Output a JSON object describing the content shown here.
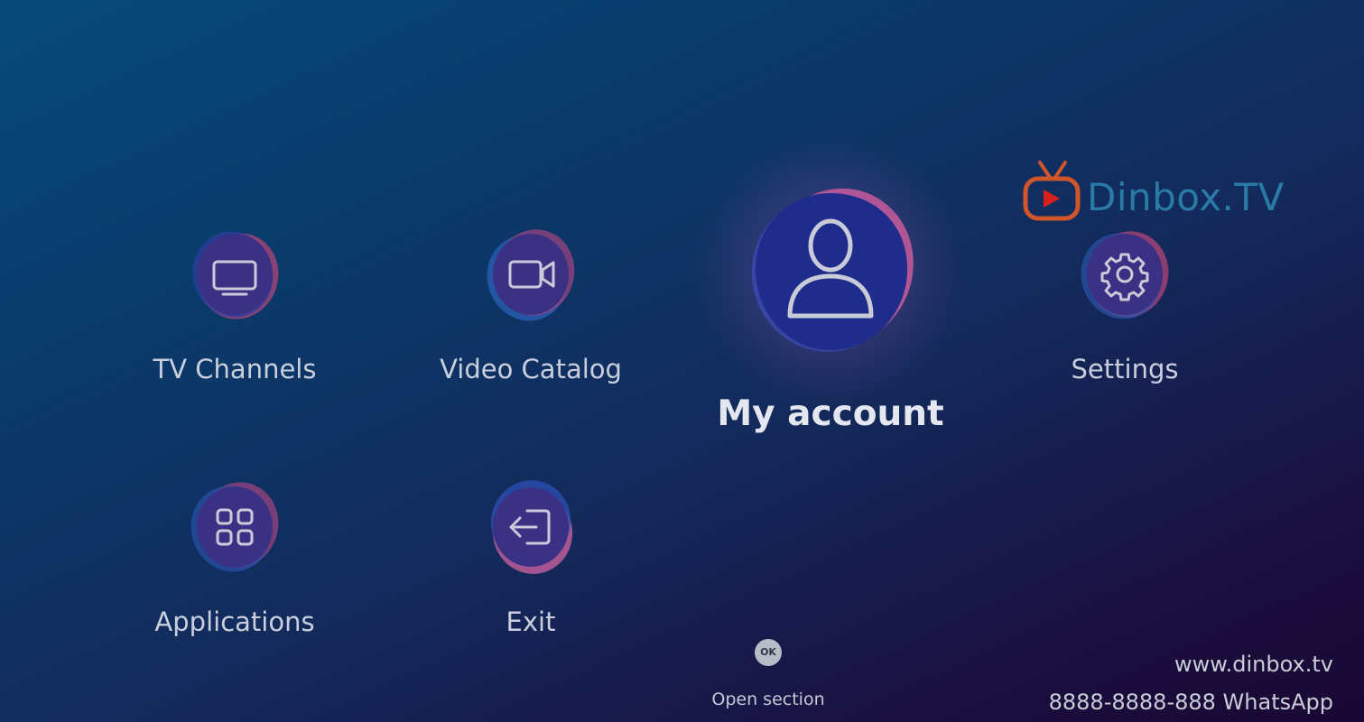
{
  "brand": {
    "name": "Dinbox.TV",
    "colors": {
      "tv_outline": "#d0562a",
      "play": "#d8201c",
      "text": "#2a7aa8"
    }
  },
  "menu": {
    "tv_channels": {
      "label": "TV Channels",
      "icon": "tv-icon"
    },
    "video_catalog": {
      "label": "Video Catalog",
      "icon": "video-camera-icon"
    },
    "my_account": {
      "label": "My account",
      "icon": "user-icon",
      "focused": true
    },
    "settings": {
      "label": "Settings",
      "icon": "gear-icon"
    },
    "applications": {
      "label": "Applications",
      "icon": "apps-grid-icon"
    },
    "exit": {
      "label": "Exit",
      "icon": "exit-icon"
    }
  },
  "hint": {
    "key": "OK",
    "text": "Open section"
  },
  "footer": {
    "website": "www.dinbox.tv",
    "whatsapp": "8888-8888-888 WhatsApp"
  }
}
